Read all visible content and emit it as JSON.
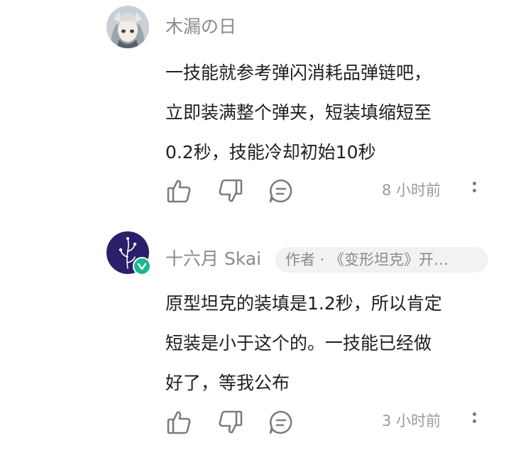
{
  "comments": [
    {
      "username": "木漏の日",
      "lines": [
        "一技能就参考弹闪消耗品弹链吧，",
        "立即装满整个弹夹，短装填缩短至",
        "0.2秒，技能冷却初始10秒"
      ],
      "time": "8 小时前",
      "avatar_icon": "anime-girl-avatar"
    },
    {
      "username": "十六月 Skai",
      "badge": "作者 · 《变形坦克》开…",
      "lines": [
        "原型坦克的装填是1.2秒，所以肯定",
        "短装是小于这个的。一技能已经做",
        "好了，等我公布"
      ],
      "time": "3 小时前",
      "avatar_icon": "plant-sprout-avatar"
    }
  ],
  "colors": {
    "text": "#1f1f1f",
    "meta": "#8a8a8a",
    "icon": "#7d7d7d",
    "verified": "#1bb78f",
    "avatar2_bg": "#2a1f6a",
    "badge_bg": "#f1f2f4"
  }
}
